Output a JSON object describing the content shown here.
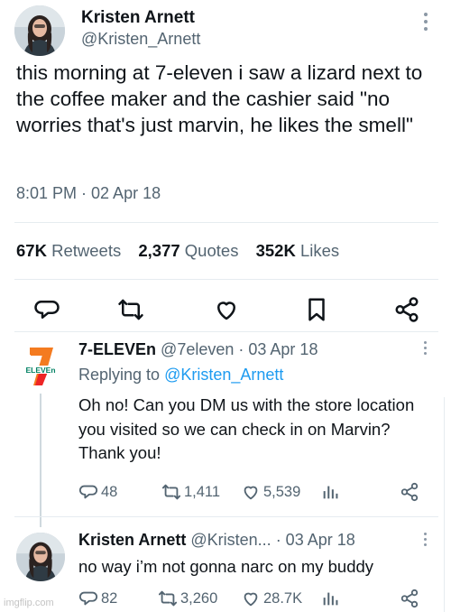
{
  "tweet": {
    "author_name": "Kristen Arnett",
    "author_handle": "@Kristen_Arnett",
    "text": "this morning at 7-eleven i saw a lizard next to the coffee maker and the cashier said \"no worries that's just marvin, he likes the smell\"",
    "meta": "8:01 PM · 02 Apr 18",
    "stats": {
      "retweets_count": "67K",
      "retweets_label": "Retweets",
      "quotes_count": "2,377",
      "quotes_label": "Quotes",
      "likes_count": "352K",
      "likes_label": "Likes"
    },
    "actions": [
      "reply-icon",
      "retweet-icon",
      "like-icon",
      "bookmark-icon",
      "share-icon"
    ]
  },
  "replies": [
    {
      "name": "7-ELEVEn",
      "handle": "@7eleven",
      "date": "· 03 Apr 18",
      "replying_prefix": "Replying to",
      "replying_to": "@Kristen_Arnett",
      "text": "Oh no! Can you DM us with the store location you visited so we can check in on Marvin? Thank you!",
      "replies": "48",
      "retweets": "1,411",
      "likes": "5,539",
      "logo_text": "ELEVEn"
    },
    {
      "name": "Kristen Arnett",
      "handle": "@Kristen...",
      "date": "· 03 Apr 18",
      "text": "no way i’m not gonna narc on my buddy",
      "replies": "82",
      "retweets": "3,260",
      "likes": "28.7K"
    }
  ],
  "watermark": "imgflip.com",
  "colors": {
    "text": "#0f1419",
    "secondary": "#536471",
    "link": "#1d9bf0",
    "divider": "#e6ecf0",
    "seven_orange": "#f47b20",
    "seven_green": "#008163",
    "seven_red": "#ee2526"
  }
}
